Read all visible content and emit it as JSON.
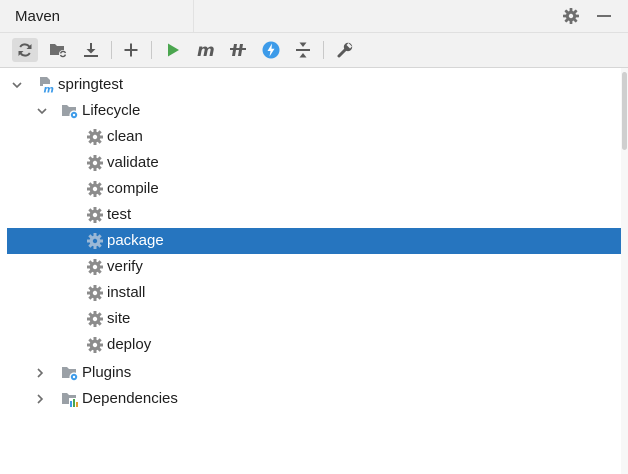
{
  "panel": {
    "title": "Maven",
    "settings_icon": "gear-icon",
    "hide_icon": "minimize-icon"
  },
  "toolbar": {
    "buttons": [
      {
        "name": "reload-all-projects",
        "icon": "refresh-icon"
      },
      {
        "name": "generate-sources",
        "icon": "folder-refresh-icon"
      },
      {
        "name": "download-sources",
        "icon": "download-icon"
      },
      {
        "name": "add-maven-project",
        "icon": "plus-icon"
      },
      {
        "name": "run-maven-build",
        "icon": "run-icon"
      },
      {
        "name": "execute-maven-goal",
        "icon": "maven-m-icon"
      },
      {
        "name": "toggle-offline-mode",
        "icon": "offline-icon"
      },
      {
        "name": "skip-tests",
        "icon": "lightning-icon"
      },
      {
        "name": "collapse-all",
        "icon": "collapse-icon"
      },
      {
        "name": "maven-settings",
        "icon": "wrench-icon"
      }
    ]
  },
  "tree": {
    "project": {
      "label": "springtest",
      "expanded": true
    },
    "lifecycle": {
      "label": "Lifecycle",
      "expanded": true
    },
    "goals": [
      {
        "label": "clean",
        "selected": false
      },
      {
        "label": "validate",
        "selected": false
      },
      {
        "label": "compile",
        "selected": false
      },
      {
        "label": "test",
        "selected": false
      },
      {
        "label": "package",
        "selected": true
      },
      {
        "label": "verify",
        "selected": false
      },
      {
        "label": "install",
        "selected": false
      },
      {
        "label": "site",
        "selected": false
      },
      {
        "label": "deploy",
        "selected": false
      }
    ],
    "plugins": {
      "label": "Plugins",
      "expanded": false
    },
    "dependencies": {
      "label": "Dependencies",
      "expanded": false
    }
  },
  "colors": {
    "selection": "#2675bf",
    "run_green": "#4ba64f",
    "lightning_blue": "#3d9be9",
    "gear_gray": "#8c8c8c"
  }
}
